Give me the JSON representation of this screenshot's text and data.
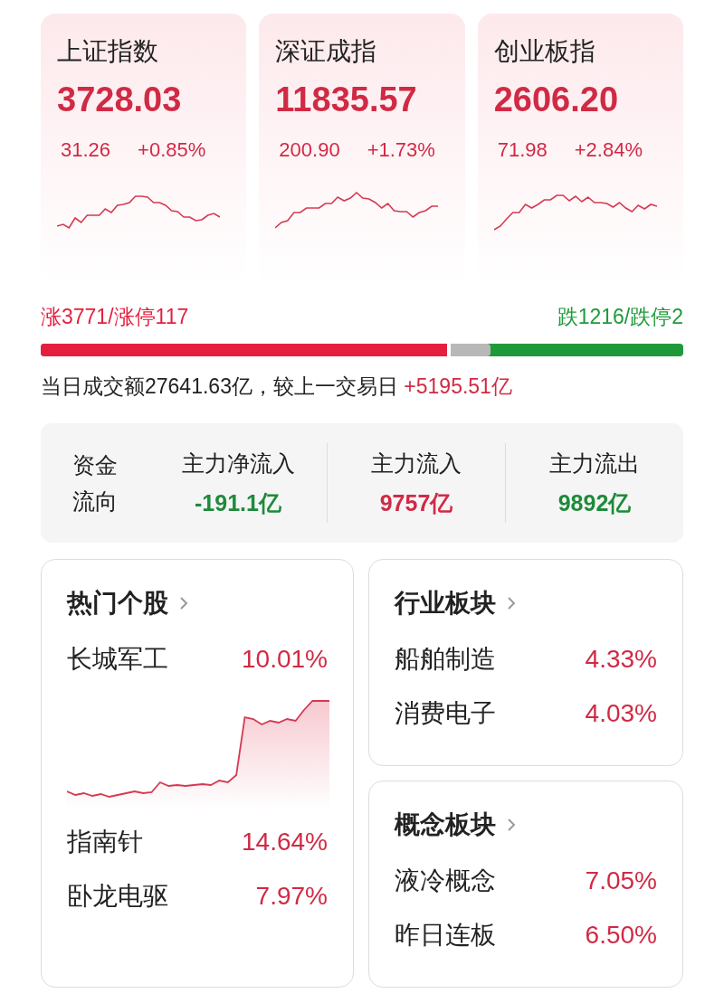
{
  "indices": [
    {
      "name": "上证指数",
      "value": "3728.03",
      "change": "31.26",
      "percent": "+0.85%"
    },
    {
      "name": "深证成指",
      "value": "11835.57",
      "change": "200.90",
      "percent": "+1.73%"
    },
    {
      "name": "创业板指",
      "value": "2606.20",
      "change": "71.98",
      "percent": "+2.84%"
    }
  ],
  "breadth": {
    "up_label": "涨3771/涨停117",
    "down_label": "跌1216/跌停2",
    "level": 0.7
  },
  "turnover": {
    "text": "当日成交额27641.63亿，较上一交易日",
    "delta": "+5195.51亿"
  },
  "fund_flow": {
    "title_lines": [
      "资金",
      "流向"
    ],
    "items": [
      {
        "label": "主力净流入",
        "value": "-191.1亿",
        "color": "#1f8a3a"
      },
      {
        "label": "主力流入",
        "value": "9757亿",
        "color": "#d02a45"
      },
      {
        "label": "主力流出",
        "value": "9892亿",
        "color": "#1f8a3a"
      }
    ]
  },
  "hot_stocks": {
    "title": "热门个股",
    "top": {
      "name": "长城军工",
      "percent": "10.01%"
    },
    "items": [
      {
        "name": "指南针",
        "percent": "14.64%"
      },
      {
        "name": "卧龙电驱",
        "percent": "7.97%"
      }
    ]
  },
  "industry": {
    "title": "行业板块",
    "items": [
      {
        "name": "船舶制造",
        "percent": "4.33%"
      },
      {
        "name": "消费电子",
        "percent": "4.03%"
      }
    ]
  },
  "concept": {
    "title": "概念板块",
    "items": [
      {
        "name": "液冷概念",
        "percent": "7.05%"
      },
      {
        "name": "昨日连板",
        "percent": "6.50%"
      }
    ]
  }
}
